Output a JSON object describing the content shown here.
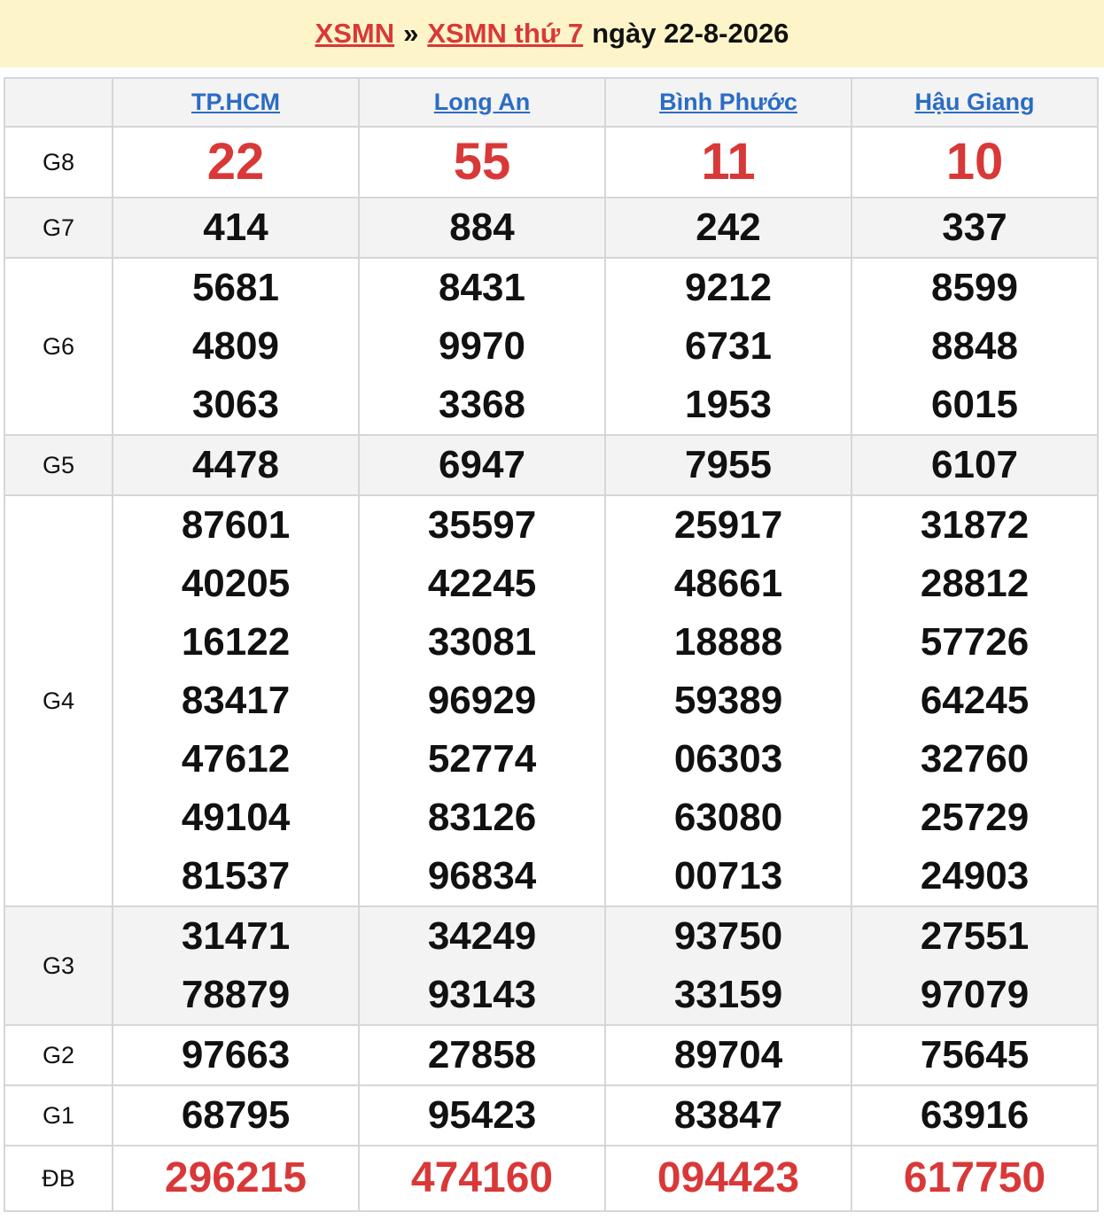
{
  "header": {
    "link1": "XSMN",
    "sep": "»",
    "link2": "XSMN thứ 7",
    "date_text": "ngày 22-8-2026"
  },
  "provinces": [
    "TP.HCM",
    "Long An",
    "Bình Phước",
    "Hậu Giang"
  ],
  "prizes": [
    {
      "label": "G8",
      "style": "big",
      "alt": false,
      "values": [
        [
          "22"
        ],
        [
          "55"
        ],
        [
          "11"
        ],
        [
          "10"
        ]
      ]
    },
    {
      "label": "G7",
      "style": "num",
      "alt": true,
      "values": [
        [
          "414"
        ],
        [
          "884"
        ],
        [
          "242"
        ],
        [
          "337"
        ]
      ]
    },
    {
      "label": "G6",
      "style": "num",
      "alt": false,
      "values": [
        [
          "5681",
          "4809",
          "3063"
        ],
        [
          "8431",
          "9970",
          "3368"
        ],
        [
          "9212",
          "6731",
          "1953"
        ],
        [
          "8599",
          "8848",
          "6015"
        ]
      ]
    },
    {
      "label": "G5",
      "style": "num",
      "alt": true,
      "values": [
        [
          "4478"
        ],
        [
          "6947"
        ],
        [
          "7955"
        ],
        [
          "6107"
        ]
      ]
    },
    {
      "label": "G4",
      "style": "num",
      "alt": false,
      "values": [
        [
          "87601",
          "40205",
          "16122",
          "83417",
          "47612",
          "49104",
          "81537"
        ],
        [
          "35597",
          "42245",
          "33081",
          "96929",
          "52774",
          "83126",
          "96834"
        ],
        [
          "25917",
          "48661",
          "18888",
          "59389",
          "06303",
          "63080",
          "00713"
        ],
        [
          "31872",
          "28812",
          "57726",
          "64245",
          "32760",
          "25729",
          "24903"
        ]
      ]
    },
    {
      "label": "G3",
      "style": "num",
      "alt": true,
      "values": [
        [
          "31471",
          "78879"
        ],
        [
          "34249",
          "93143"
        ],
        [
          "93750",
          "33159"
        ],
        [
          "27551",
          "97079"
        ]
      ]
    },
    {
      "label": "G2",
      "style": "num",
      "alt": false,
      "values": [
        [
          "97663"
        ],
        [
          "27858"
        ],
        [
          "89704"
        ],
        [
          "75645"
        ]
      ]
    },
    {
      "label": "G1",
      "style": "num",
      "alt": false,
      "values": [
        [
          "68795"
        ],
        [
          "95423"
        ],
        [
          "83847"
        ],
        [
          "63916"
        ]
      ]
    },
    {
      "label": "ĐB",
      "style": "db",
      "alt": false,
      "values": [
        [
          "296215"
        ],
        [
          "474160"
        ],
        [
          "094423"
        ],
        [
          "617750"
        ]
      ]
    }
  ],
  "colors": {
    "accent_red": "#d93838",
    "link_blue": "#2b6cc4",
    "header_bg": "#fdf5c9"
  }
}
